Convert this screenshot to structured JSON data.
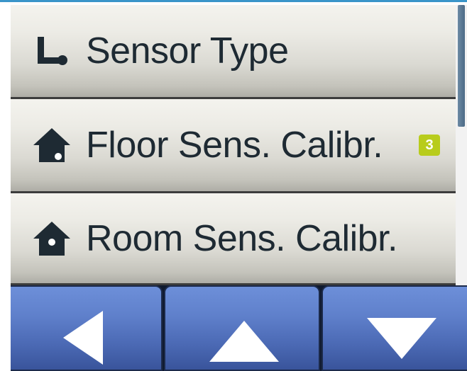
{
  "menu": {
    "items": [
      {
        "label": "Sensor Type",
        "icon": "sensor-probe-icon"
      },
      {
        "label": "Floor Sens. Calibr.",
        "icon": "house-floor-sensor-icon",
        "badge": "3"
      },
      {
        "label": "Room Sens. Calibr.",
        "icon": "house-room-sensor-icon"
      }
    ]
  },
  "navigation": {
    "back_icon": "left-arrow-icon",
    "up_icon": "up-arrow-icon",
    "down_icon": "down-arrow-icon"
  },
  "colors": {
    "accent_strip": "#3a95c9",
    "badge": "#b8cc1c",
    "nav_button": "#5f80cb",
    "icon": "#1e2a33"
  }
}
